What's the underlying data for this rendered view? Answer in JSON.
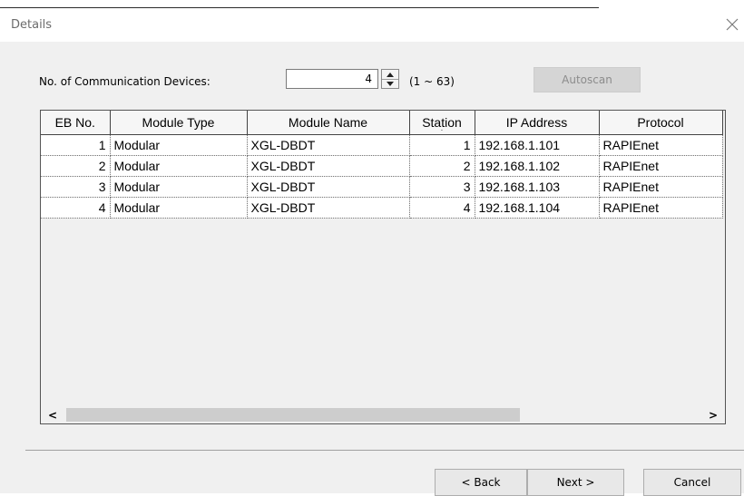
{
  "dialog": {
    "title": "Details"
  },
  "devices": {
    "label": "No. of Communication Devices:",
    "value": "4",
    "range": "(1 ~ 63)",
    "autoscan_label": "Autoscan"
  },
  "table": {
    "columns": [
      "EB No.",
      "Module Type",
      "Module Name",
      "Station",
      "IP Address",
      "Protocol"
    ],
    "rows": [
      [
        "1",
        "Modular",
        "XGL-DBDT",
        "1",
        "192.168.1.101",
        "RAPIEnet"
      ],
      [
        "2",
        "Modular",
        "XGL-DBDT",
        "2",
        "192.168.1.102",
        "RAPIEnet"
      ],
      [
        "3",
        "Modular",
        "XGL-DBDT",
        "3",
        "192.168.1.103",
        "RAPIEnet"
      ],
      [
        "4",
        "Modular",
        "XGL-DBDT",
        "4",
        "192.168.1.104",
        "RAPIEnet"
      ]
    ],
    "scroll_left": "<",
    "scroll_right": ">"
  },
  "buttons": {
    "back": "< Back",
    "next": "Next >",
    "cancel": "Cancel"
  }
}
